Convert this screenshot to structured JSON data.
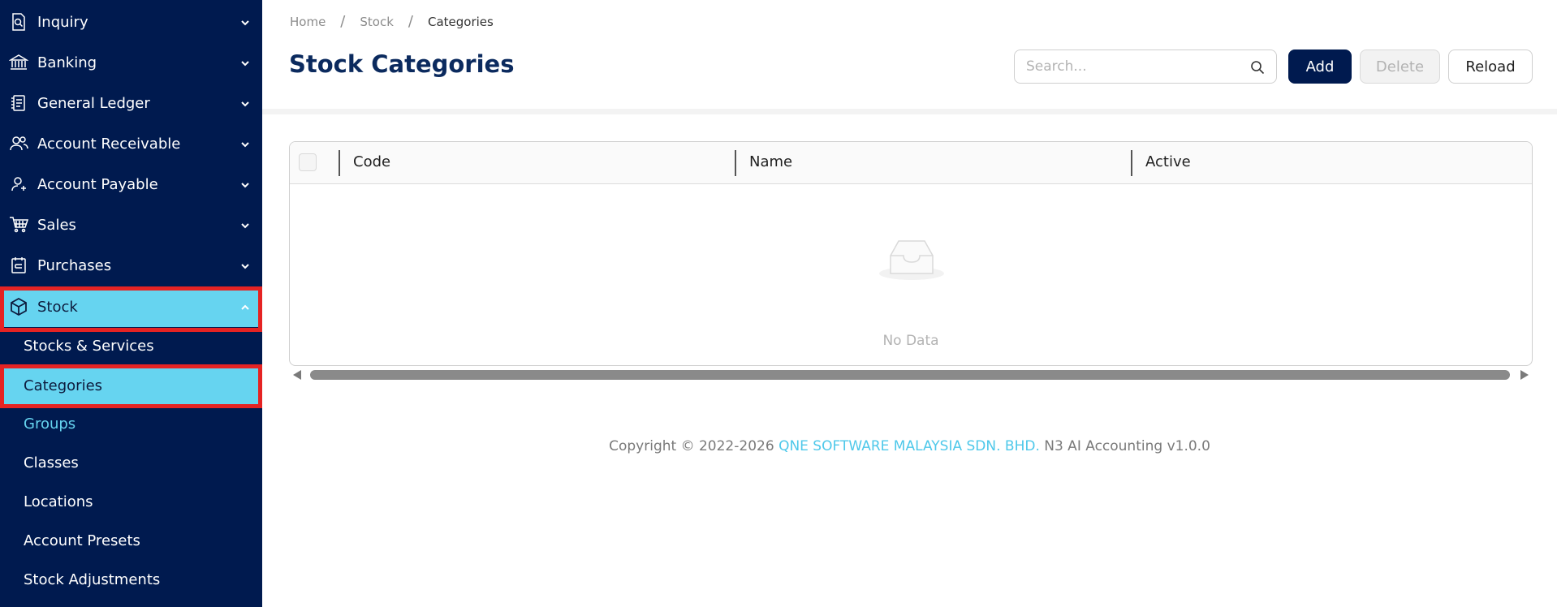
{
  "sidebar": {
    "items": [
      {
        "label": "Inquiry",
        "icon": "inquiry-icon"
      },
      {
        "label": "Banking",
        "icon": "bank-icon"
      },
      {
        "label": "General Ledger",
        "icon": "ledger-icon"
      },
      {
        "label": "Account Receivable",
        "icon": "users-icon"
      },
      {
        "label": "Account Payable",
        "icon": "user-icon"
      },
      {
        "label": "Sales",
        "icon": "cart-icon"
      },
      {
        "label": "Purchases",
        "icon": "purchase-icon"
      },
      {
        "label": "Stock",
        "icon": "box-icon"
      }
    ],
    "sub_items": [
      {
        "label": "Stocks & Services"
      },
      {
        "label": "Categories"
      },
      {
        "label": "Groups"
      },
      {
        "label": "Classes"
      },
      {
        "label": "Locations"
      },
      {
        "label": "Account Presets"
      },
      {
        "label": "Stock Adjustments"
      }
    ]
  },
  "breadcrumb": {
    "items": [
      "Home",
      "Stock",
      "Categories"
    ],
    "separator": "/"
  },
  "page": {
    "title": "Stock Categories"
  },
  "toolbar": {
    "search_placeholder": "Search...",
    "add_label": "Add",
    "delete_label": "Delete",
    "reload_label": "Reload"
  },
  "table": {
    "columns": [
      "Code",
      "Name",
      "Active"
    ],
    "empty_text": "No Data"
  },
  "footer": {
    "prefix": "Copyright © 2022-2026",
    "company": "QNE SOFTWARE MALAYSIA SDN. BHD.",
    "suffix": "N3 AI Accounting v1.0.0"
  },
  "colors": {
    "sidebar_bg": "#001a4f",
    "active_bg": "#66d4f0",
    "highlight_border": "#e52323",
    "title": "#0b2a5e",
    "link": "#4ec8ea"
  }
}
